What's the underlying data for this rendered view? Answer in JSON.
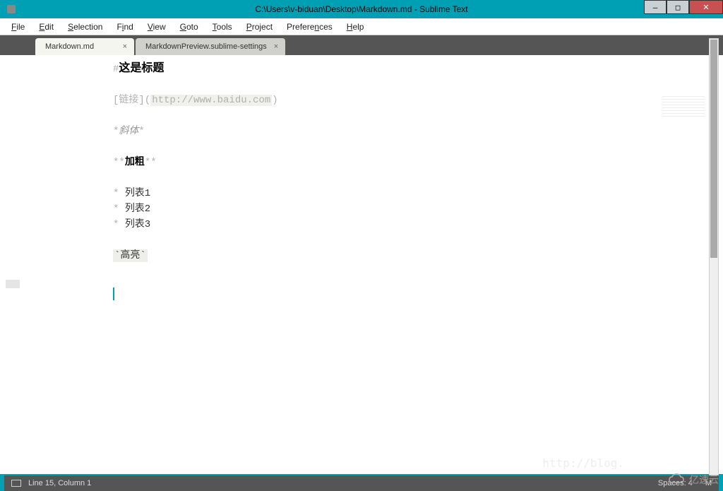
{
  "window": {
    "title": "C:\\Users\\v-biduan\\Desktop\\Markdown.md - Sublime Text"
  },
  "menu": {
    "file": "File",
    "edit": "Edit",
    "selection": "Selection",
    "find": "Find",
    "view": "View",
    "goto": "Goto",
    "tools": "Tools",
    "project": "Project",
    "preferences": "Preferences",
    "help": "Help"
  },
  "tabs": {
    "active": {
      "label": "Markdown.md"
    },
    "inactive": {
      "label": "MarkdownPreview.sublime-settings"
    }
  },
  "editor": {
    "heading_marker": "#",
    "heading_text": "这是标题",
    "link_text": "链接",
    "link_url": "http://www.baidu.com",
    "italic_marker": "*",
    "italic_text": "斜体",
    "bold_marker": "**",
    "bold_text": "加粗",
    "list_marker": "*",
    "list_items": [
      "列表1",
      "列表2",
      "列表3"
    ],
    "code_marker": "`",
    "code_text": "高亮"
  },
  "status": {
    "line_col": "Line 15, Column 1",
    "spaces": "Spaces: 4",
    "syntax": "M"
  },
  "watermark": {
    "text": "亿速云",
    "url": "http://blog."
  }
}
